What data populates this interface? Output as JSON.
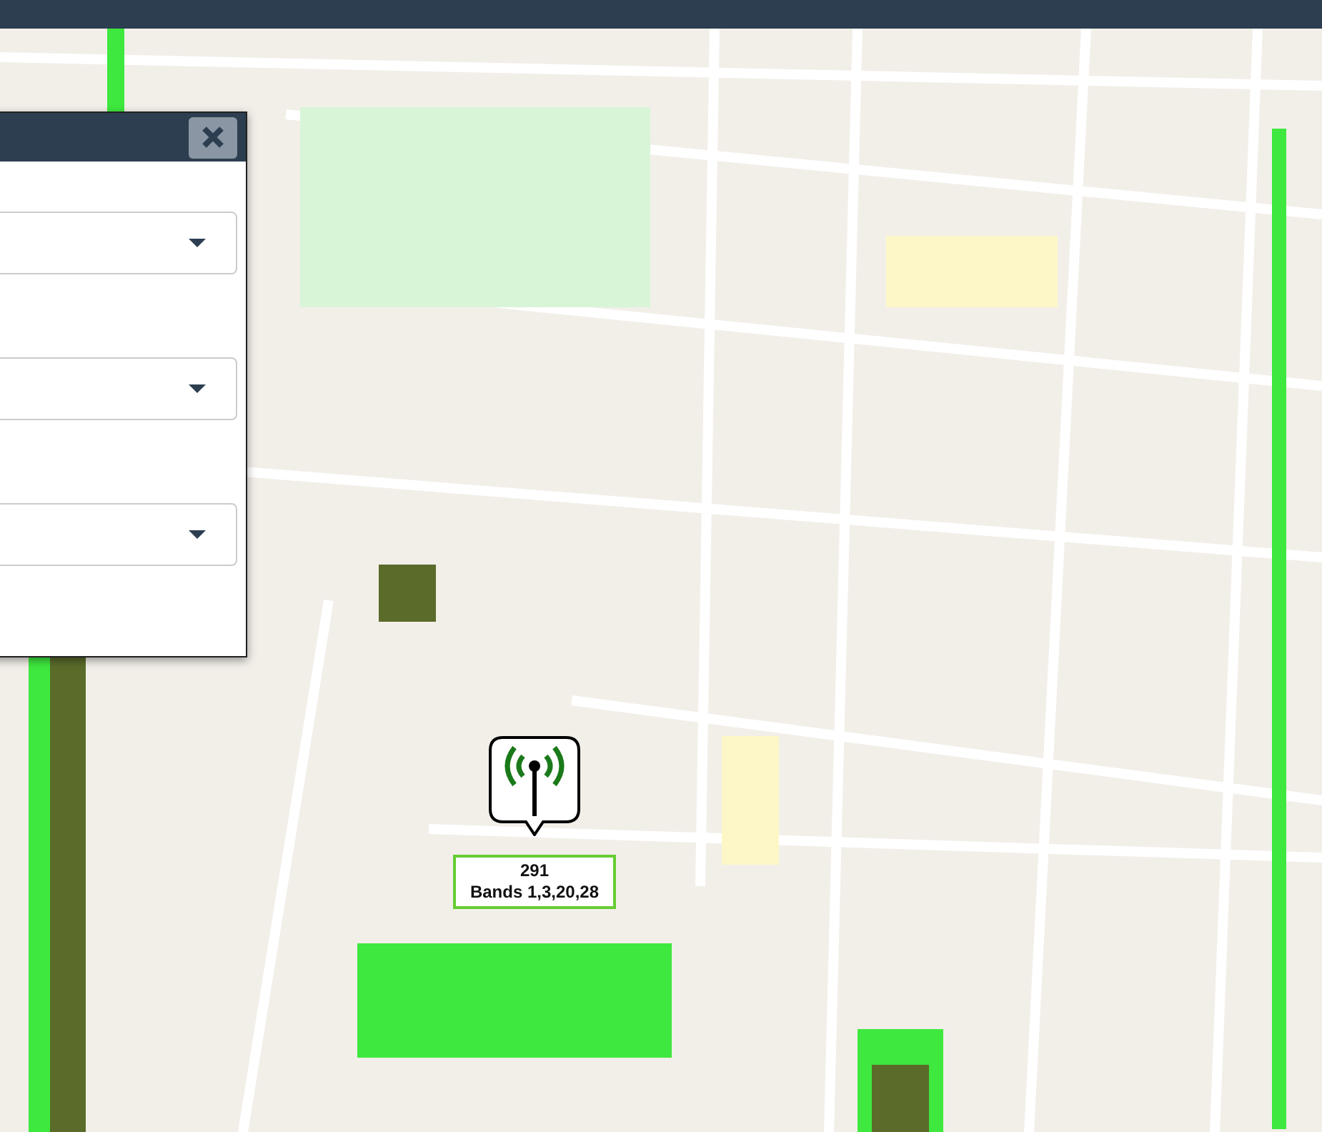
{
  "panel": {
    "dropdowns": [
      {
        "expanded": false
      },
      {
        "expanded": false
      },
      {
        "expanded": false
      }
    ]
  },
  "site_marker": {
    "label_lines": [
      "291",
      "Bands 1,3,20,28"
    ]
  }
}
